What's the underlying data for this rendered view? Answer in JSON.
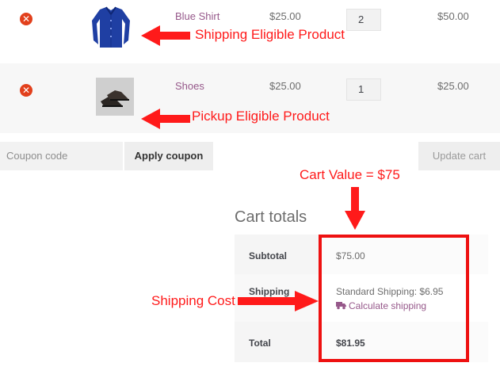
{
  "cart": {
    "items": [
      {
        "name": "Blue Shirt",
        "price": "$25.00",
        "quantity": "2",
        "subtotal": "$50.00",
        "image": "blue-shirt"
      },
      {
        "name": "Shoes",
        "price": "$25.00",
        "quantity": "1",
        "subtotal": "$25.00",
        "image": "shoes"
      }
    ],
    "remove_glyph": "✕",
    "coupon_placeholder": "Coupon code",
    "apply_coupon_label": "Apply coupon",
    "update_cart_label": "Update cart"
  },
  "totals": {
    "title": "Cart totals",
    "subtotal_label": "Subtotal",
    "subtotal_value": "$75.00",
    "shipping_label": "Shipping",
    "shipping_method": "Standard Shipping: $6.95",
    "calculate_shipping": "Calculate shipping",
    "total_label": "Total",
    "total_value": "$81.95"
  },
  "annotations": {
    "shipping_eligible": "Shipping Eligible Product",
    "pickup_eligible": "Pickup Eligible Product",
    "cart_value": "Cart Value = $75",
    "shipping_cost": "Shipping Cost"
  },
  "colors": {
    "annotation_red": "#ff1a1a",
    "remove_icon": "#e2401c",
    "link_purple": "#96588a"
  }
}
